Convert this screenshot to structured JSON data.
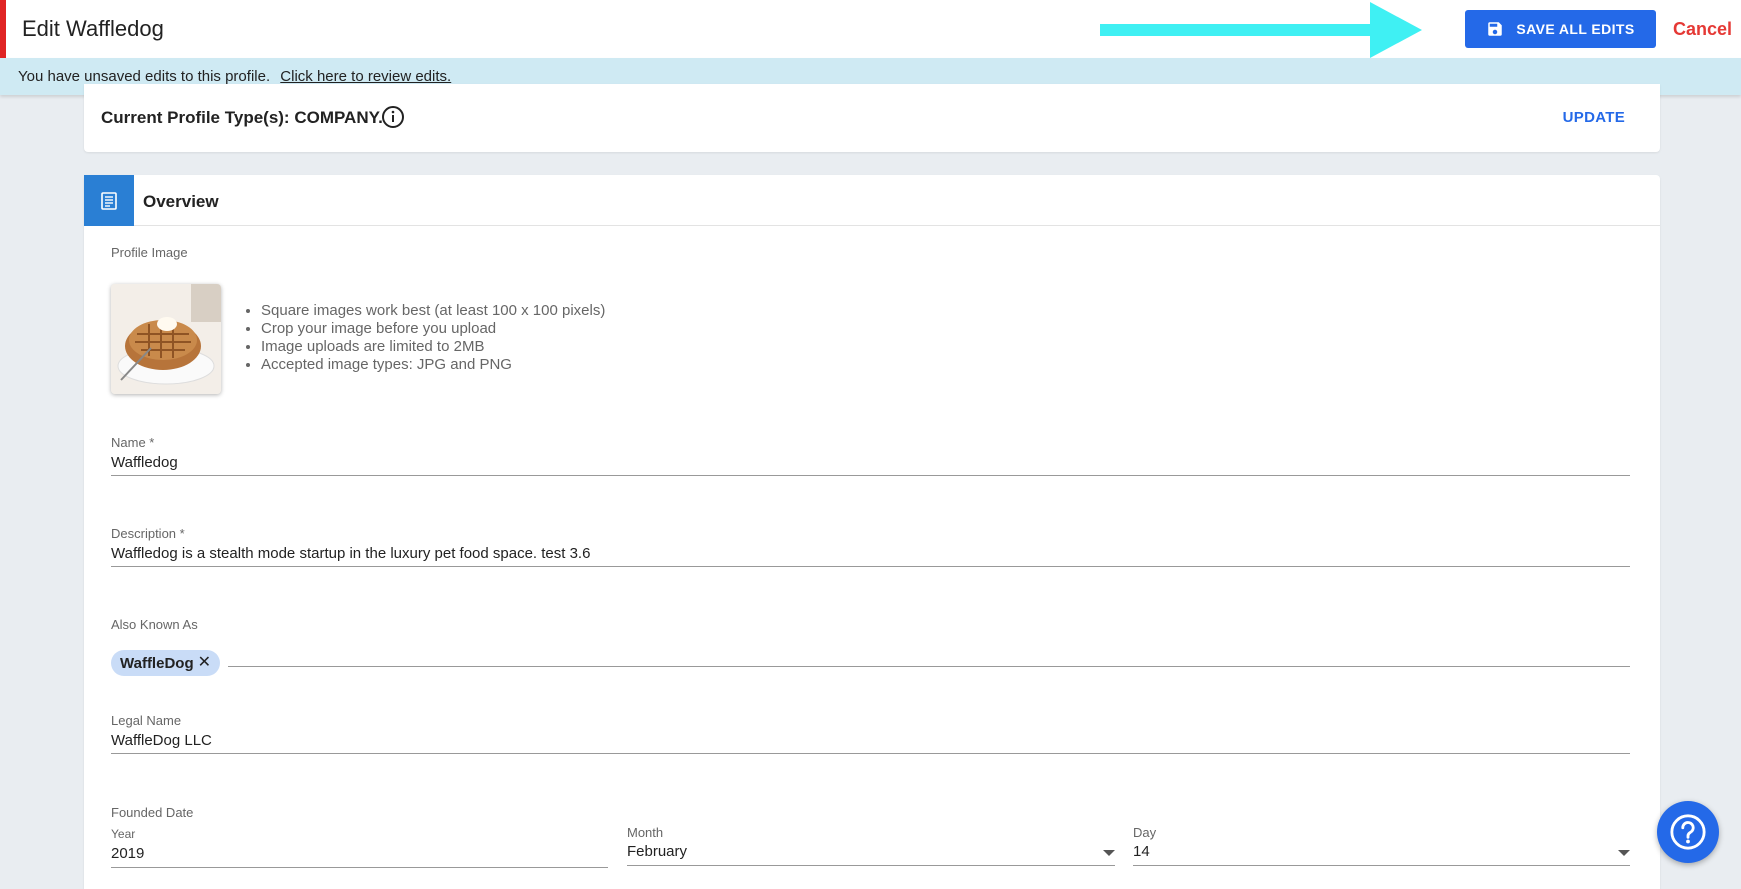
{
  "header": {
    "title": "Edit Waffledog",
    "save_label": "SAVE ALL EDITS",
    "cancel_label": "Cancel"
  },
  "banner": {
    "message": "You have unsaved edits to this profile.",
    "link_text": "Click here to review edits."
  },
  "profile_type": {
    "text": "Current Profile Type(s): COMPANY.",
    "update_label": "UPDATE"
  },
  "overview": {
    "title": "Overview",
    "profile_image_label": "Profile Image",
    "image_tips": [
      "Square images work best (at least 100 x 100 pixels)",
      "Crop your image before you upload",
      "Image uploads are limited to 2MB",
      "Accepted image types: JPG and PNG"
    ],
    "name": {
      "label": "Name *",
      "value": "Waffledog"
    },
    "description": {
      "label": "Description *",
      "value": "Waffledog is a stealth mode startup in the luxury pet food space. test 3.6"
    },
    "aka": {
      "label": "Also Known As",
      "chips": [
        "WaffleDog"
      ]
    },
    "legal_name": {
      "label": "Legal Name",
      "value": "WaffleDog LLC"
    },
    "founded": {
      "label": "Founded Date",
      "year_label": "Year",
      "year_value": "2019",
      "month_label": "Month",
      "month_value": "February",
      "day_label": "Day",
      "day_value": "14"
    }
  },
  "colors": {
    "accent_blue": "#2469e8",
    "cancel_red": "#e53935",
    "banner_bg": "#cfeaf3",
    "arrow_cyan": "#3ff0f3"
  },
  "icons": {
    "save": "floppy-disk-icon",
    "info": "info-circle-icon",
    "overview": "document-icon",
    "help": "question-mark-icon"
  }
}
